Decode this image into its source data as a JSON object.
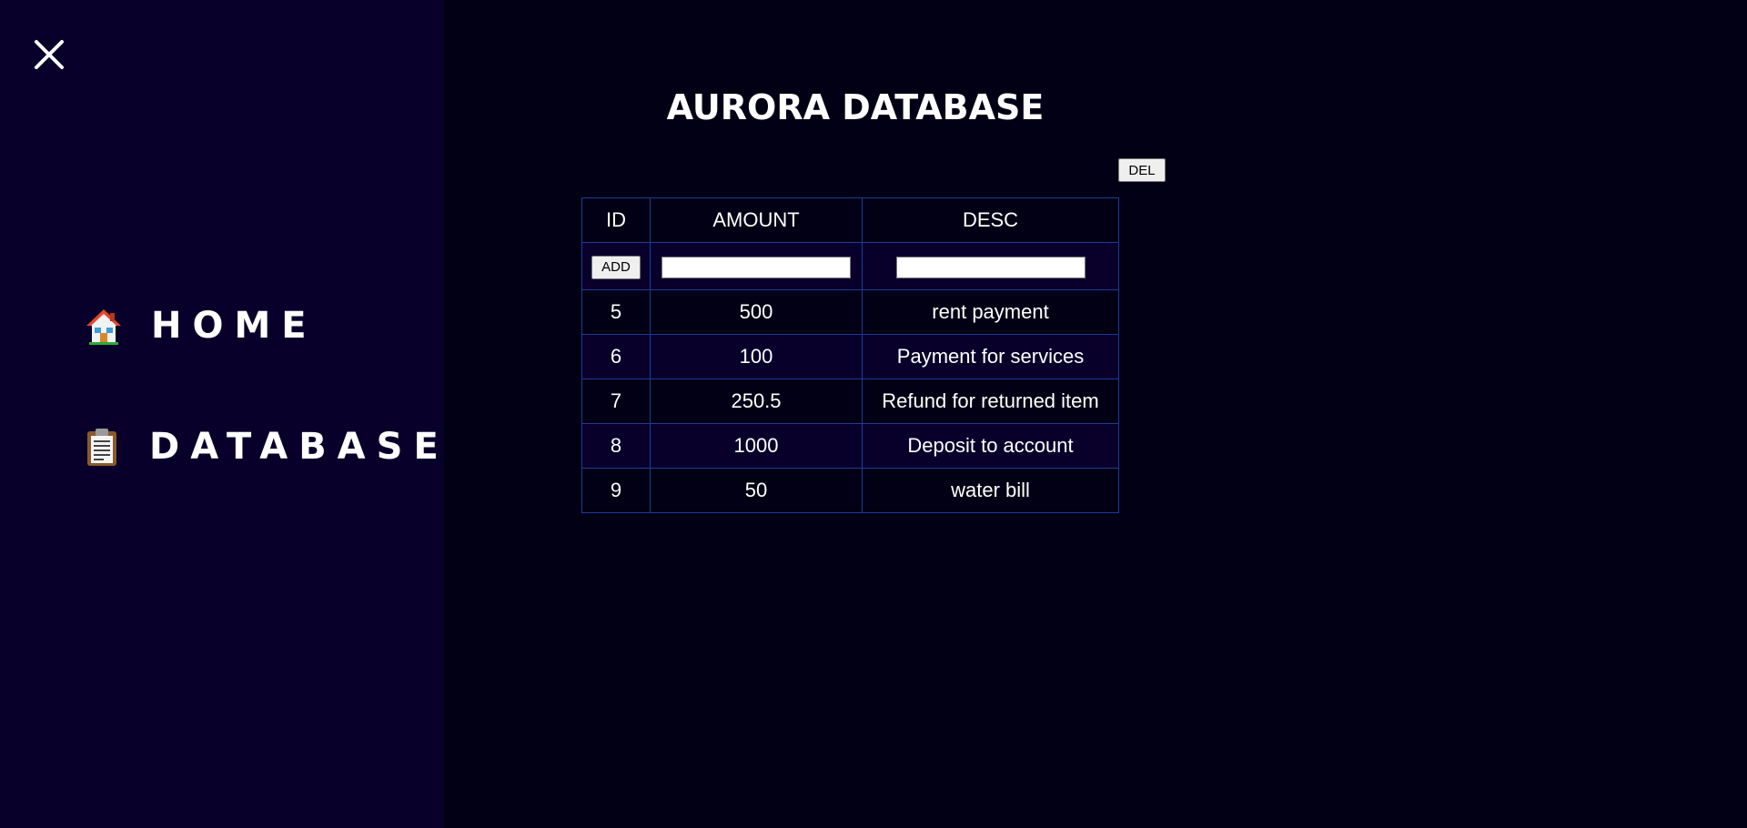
{
  "sidebar": {
    "close_icon": "close-icon",
    "items": [
      {
        "label": "HOME",
        "icon": "house-icon"
      },
      {
        "label": "DATABASE",
        "icon": "clipboard-icon"
      }
    ]
  },
  "main": {
    "title": "AURORA DATABASE",
    "del_label": "DEL",
    "add_label": "ADD",
    "amount_input": {
      "value": "",
      "placeholder": ""
    },
    "desc_input": {
      "value": "",
      "placeholder": ""
    },
    "table": {
      "headers": [
        "ID",
        "AMOUNT",
        "DESC"
      ],
      "rows": [
        [
          "5",
          "500",
          "rent payment"
        ],
        [
          "6",
          "100",
          "Payment for services"
        ],
        [
          "7",
          "250.5",
          "Refund for returned item"
        ],
        [
          "8",
          "1000",
          "Deposit to account"
        ],
        [
          "9",
          "50",
          "water bill"
        ]
      ]
    }
  },
  "colors": {
    "sidebar_bg": "#08002b",
    "main_bg": "#020014",
    "table_border": "#1f3a9a",
    "text": "#ffffff"
  }
}
